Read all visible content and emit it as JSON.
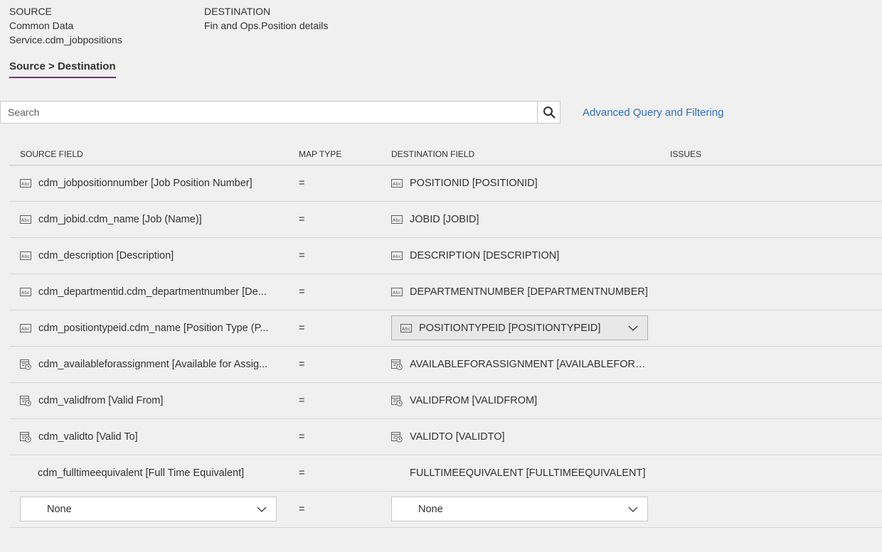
{
  "header": {
    "source_label": "SOURCE",
    "source_value": "Common Data Service.cdm_jobpositions",
    "destination_label": "DESTINATION",
    "destination_value": "Fin and Ops.Position details"
  },
  "pivot": {
    "label": "Source > Destination"
  },
  "search": {
    "placeholder": "Search"
  },
  "advanced_link": "Advanced Query and Filtering",
  "columns": {
    "source": "SOURCE FIELD",
    "map": "MAP TYPE",
    "destination": "DESTINATION FIELD",
    "issues": "ISSUES"
  },
  "rows": [
    {
      "source": "cdm_jobpositionnumber [Job Position Number]",
      "map": "=",
      "destination": "POSITIONID [POSITIONID]",
      "icon": "text-field-icon"
    },
    {
      "source": "cdm_jobid.cdm_name [Job (Name)]",
      "map": "=",
      "destination": "JOBID [JOBID]",
      "icon": "text-field-icon"
    },
    {
      "source": "cdm_description [Description]",
      "map": "=",
      "destination": "DESCRIPTION [DESCRIPTION]",
      "icon": "text-field-icon"
    },
    {
      "source": "cdm_departmentid.cdm_departmentnumber [De...",
      "map": "=",
      "destination": "DEPARTMENTNUMBER [DEPARTMENTNUMBER]",
      "icon": "text-field-icon"
    },
    {
      "source": "cdm_positiontypeid.cdm_name [Position Type (P...",
      "map": "=",
      "destination": "POSITIONTYPEID [POSITIONTYPEID]",
      "icon": "text-field-icon"
    },
    {
      "source": "cdm_availableforassignment [Available for Assig...",
      "map": "=",
      "destination": "AVAILABLEFORASSIGNMENT [AVAILABLEFORASS...",
      "icon": "datetime-field-icon"
    },
    {
      "source": "cdm_validfrom [Valid From]",
      "map": "=",
      "destination": "VALIDFROM [VALIDFROM]",
      "icon": "datetime-field-icon"
    },
    {
      "source": "cdm_validto [Valid To]",
      "map": "=",
      "destination": "VALIDTO [VALIDTO]",
      "icon": "datetime-field-icon"
    },
    {
      "source": "cdm_fulltimeequivalent [Full Time Equivalent]",
      "map": "=",
      "destination": "FULLTIMEEQUIVALENT [FULLTIMEEQUIVALENT]",
      "icon": ""
    }
  ],
  "new_row": {
    "source_selected": "None",
    "map": "=",
    "destination_selected": "None"
  },
  "colors": {
    "accent_underline": "#8f1f8f",
    "link": "#2f6fbf"
  }
}
